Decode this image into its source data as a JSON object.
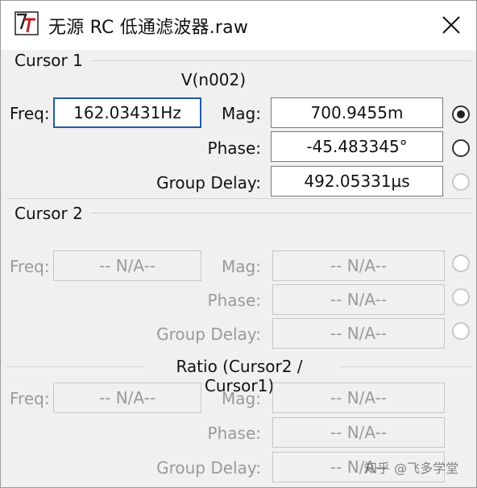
{
  "window": {
    "title": "无源 RC 低通滤波器.raw",
    "close_icon": "close-icon"
  },
  "cursor1": {
    "section_label": "Cursor 1",
    "trace": "V(n002)",
    "freq_label": "Freq:",
    "freq_value": "162.03431Hz",
    "mag_label": "Mag:",
    "mag_value": "700.9455m",
    "phase_label": "Phase:",
    "phase_value": "-45.483345°",
    "group_delay_label": "Group Delay:",
    "group_delay_value": "492.05331µs",
    "radio_selected": "mag"
  },
  "cursor2": {
    "section_label": "Cursor 2",
    "freq_label": "Freq:",
    "freq_value": "-- N/A--",
    "mag_label": "Mag:",
    "mag_value": "-- N/A--",
    "phase_label": "Phase:",
    "phase_value": "-- N/A--",
    "group_delay_label": "Group Delay:",
    "group_delay_value": "-- N/A--"
  },
  "ratio": {
    "header": "Ratio (Cursor2 / Cursor1)",
    "freq_label": "Freq:",
    "freq_value": "-- N/A--",
    "mag_label": "Mag:",
    "mag_value": "-- N/A--",
    "phase_label": "Phase:",
    "phase_value": "-- N/A--",
    "group_delay_label": "Group Delay:",
    "group_delay_value": "-- N/A--"
  },
  "watermark": "知乎 @飞多学堂"
}
